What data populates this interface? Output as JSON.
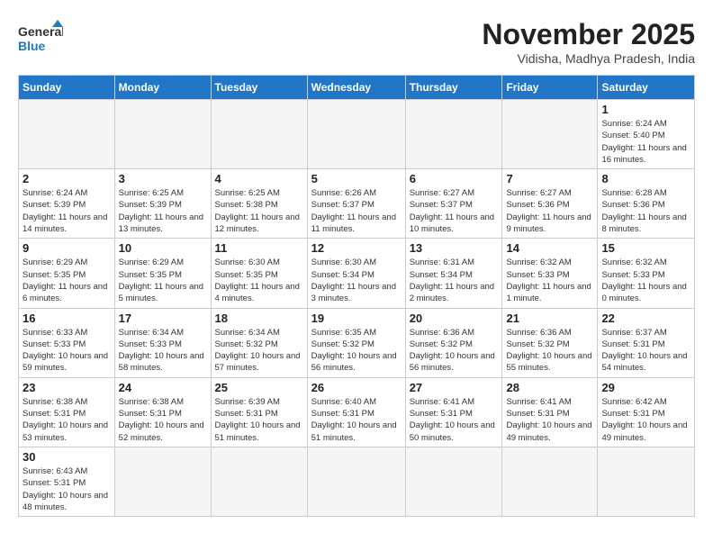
{
  "header": {
    "logo_general": "General",
    "logo_blue": "Blue",
    "month_title": "November 2025",
    "location": "Vidisha, Madhya Pradesh, India"
  },
  "weekdays": [
    "Sunday",
    "Monday",
    "Tuesday",
    "Wednesday",
    "Thursday",
    "Friday",
    "Saturday"
  ],
  "weeks": [
    {
      "days": [
        {
          "num": "",
          "info": ""
        },
        {
          "num": "",
          "info": ""
        },
        {
          "num": "",
          "info": ""
        },
        {
          "num": "",
          "info": ""
        },
        {
          "num": "",
          "info": ""
        },
        {
          "num": "",
          "info": ""
        },
        {
          "num": "1",
          "info": "Sunrise: 6:24 AM\nSunset: 5:40 PM\nDaylight: 11 hours\nand 16 minutes."
        }
      ]
    },
    {
      "days": [
        {
          "num": "2",
          "info": "Sunrise: 6:24 AM\nSunset: 5:39 PM\nDaylight: 11 hours\nand 14 minutes."
        },
        {
          "num": "3",
          "info": "Sunrise: 6:25 AM\nSunset: 5:39 PM\nDaylight: 11 hours\nand 13 minutes."
        },
        {
          "num": "4",
          "info": "Sunrise: 6:25 AM\nSunset: 5:38 PM\nDaylight: 11 hours\nand 12 minutes."
        },
        {
          "num": "5",
          "info": "Sunrise: 6:26 AM\nSunset: 5:37 PM\nDaylight: 11 hours\nand 11 minutes."
        },
        {
          "num": "6",
          "info": "Sunrise: 6:27 AM\nSunset: 5:37 PM\nDaylight: 11 hours\nand 10 minutes."
        },
        {
          "num": "7",
          "info": "Sunrise: 6:27 AM\nSunset: 5:36 PM\nDaylight: 11 hours\nand 9 minutes."
        },
        {
          "num": "8",
          "info": "Sunrise: 6:28 AM\nSunset: 5:36 PM\nDaylight: 11 hours\nand 8 minutes."
        }
      ]
    },
    {
      "days": [
        {
          "num": "9",
          "info": "Sunrise: 6:29 AM\nSunset: 5:35 PM\nDaylight: 11 hours\nand 6 minutes."
        },
        {
          "num": "10",
          "info": "Sunrise: 6:29 AM\nSunset: 5:35 PM\nDaylight: 11 hours\nand 5 minutes."
        },
        {
          "num": "11",
          "info": "Sunrise: 6:30 AM\nSunset: 5:35 PM\nDaylight: 11 hours\nand 4 minutes."
        },
        {
          "num": "12",
          "info": "Sunrise: 6:30 AM\nSunset: 5:34 PM\nDaylight: 11 hours\nand 3 minutes."
        },
        {
          "num": "13",
          "info": "Sunrise: 6:31 AM\nSunset: 5:34 PM\nDaylight: 11 hours\nand 2 minutes."
        },
        {
          "num": "14",
          "info": "Sunrise: 6:32 AM\nSunset: 5:33 PM\nDaylight: 11 hours\nand 1 minute."
        },
        {
          "num": "15",
          "info": "Sunrise: 6:32 AM\nSunset: 5:33 PM\nDaylight: 11 hours\nand 0 minutes."
        }
      ]
    },
    {
      "days": [
        {
          "num": "16",
          "info": "Sunrise: 6:33 AM\nSunset: 5:33 PM\nDaylight: 10 hours\nand 59 minutes."
        },
        {
          "num": "17",
          "info": "Sunrise: 6:34 AM\nSunset: 5:33 PM\nDaylight: 10 hours\nand 58 minutes."
        },
        {
          "num": "18",
          "info": "Sunrise: 6:34 AM\nSunset: 5:32 PM\nDaylight: 10 hours\nand 57 minutes."
        },
        {
          "num": "19",
          "info": "Sunrise: 6:35 AM\nSunset: 5:32 PM\nDaylight: 10 hours\nand 56 minutes."
        },
        {
          "num": "20",
          "info": "Sunrise: 6:36 AM\nSunset: 5:32 PM\nDaylight: 10 hours\nand 56 minutes."
        },
        {
          "num": "21",
          "info": "Sunrise: 6:36 AM\nSunset: 5:32 PM\nDaylight: 10 hours\nand 55 minutes."
        },
        {
          "num": "22",
          "info": "Sunrise: 6:37 AM\nSunset: 5:31 PM\nDaylight: 10 hours\nand 54 minutes."
        }
      ]
    },
    {
      "days": [
        {
          "num": "23",
          "info": "Sunrise: 6:38 AM\nSunset: 5:31 PM\nDaylight: 10 hours\nand 53 minutes."
        },
        {
          "num": "24",
          "info": "Sunrise: 6:38 AM\nSunset: 5:31 PM\nDaylight: 10 hours\nand 52 minutes."
        },
        {
          "num": "25",
          "info": "Sunrise: 6:39 AM\nSunset: 5:31 PM\nDaylight: 10 hours\nand 51 minutes."
        },
        {
          "num": "26",
          "info": "Sunrise: 6:40 AM\nSunset: 5:31 PM\nDaylight: 10 hours\nand 51 minutes."
        },
        {
          "num": "27",
          "info": "Sunrise: 6:41 AM\nSunset: 5:31 PM\nDaylight: 10 hours\nand 50 minutes."
        },
        {
          "num": "28",
          "info": "Sunrise: 6:41 AM\nSunset: 5:31 PM\nDaylight: 10 hours\nand 49 minutes."
        },
        {
          "num": "29",
          "info": "Sunrise: 6:42 AM\nSunset: 5:31 PM\nDaylight: 10 hours\nand 49 minutes."
        }
      ]
    },
    {
      "days": [
        {
          "num": "30",
          "info": "Sunrise: 6:43 AM\nSunset: 5:31 PM\nDaylight: 10 hours\nand 48 minutes."
        },
        {
          "num": "",
          "info": ""
        },
        {
          "num": "",
          "info": ""
        },
        {
          "num": "",
          "info": ""
        },
        {
          "num": "",
          "info": ""
        },
        {
          "num": "",
          "info": ""
        },
        {
          "num": "",
          "info": ""
        }
      ]
    }
  ]
}
